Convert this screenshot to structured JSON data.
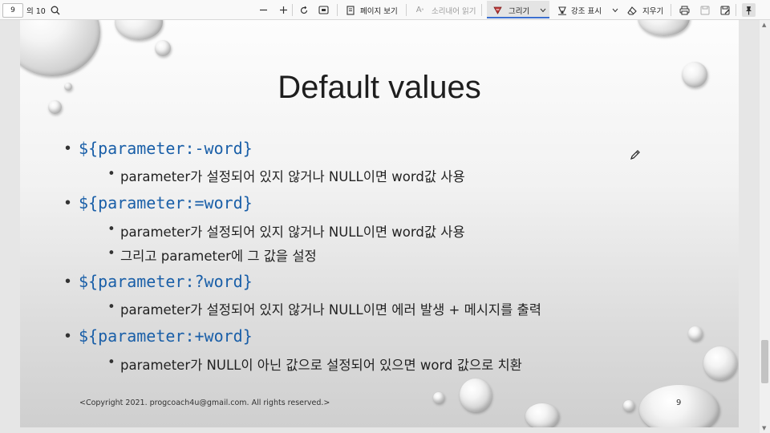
{
  "toolbar": {
    "page_current": "9",
    "page_total": "의 10",
    "page_view": "페이지 보기",
    "read_aloud": "소리내어 읽기",
    "draw": "그리기",
    "highlight": "강조 표시",
    "erase": "지우기"
  },
  "slide": {
    "title": "Default values",
    "items": [
      {
        "code": "${parameter:-word}",
        "subs": [
          "parameter가 설정되어 있지 않거나 NULL이면 word값 사용"
        ]
      },
      {
        "code": "${parameter:=word}",
        "subs": [
          "parameter가 설정되어 있지 않거나 NULL이면 word값 사용",
          "그리고 parameter에 그 값을 설정"
        ]
      },
      {
        "code": "${parameter:?word}",
        "subs": [
          "parameter가 설정되어 있지 않거나 NULL이면 에러 발생 + 메시지를 출력"
        ]
      },
      {
        "code": "${parameter:+word}",
        "subs": [
          "parameter가 NULL이 아닌 값으로 설정되어 있으면 word 값으로 치환"
        ]
      }
    ],
    "footer": "<Copyright 2021. progcoach4u@gmail.com. All rights reserved.>",
    "page_number": "9"
  },
  "colors": {
    "code_blue": "#1a5fa8",
    "accent": "#3c6fd0"
  },
  "icons": [
    "search-icon",
    "minus-icon",
    "plus-icon",
    "rotate-icon",
    "fit-icon",
    "page-view-icon",
    "read-aloud-icon",
    "draw-icon",
    "chevron-down-icon",
    "highlight-icon",
    "eraser-icon",
    "print-icon",
    "save-icon",
    "save-as-icon",
    "pin-icon",
    "pen-cursor-icon"
  ]
}
